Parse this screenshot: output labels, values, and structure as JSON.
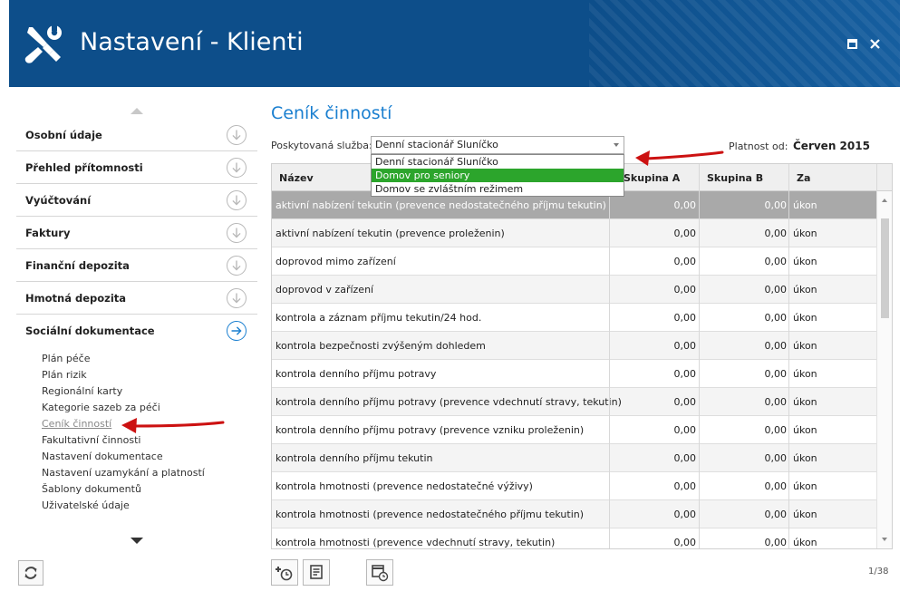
{
  "window": {
    "title": "Nastavení - Klienti",
    "maximize_icon": "maximize-icon",
    "close_icon": "close-icon",
    "header_color": "#0d4e8a"
  },
  "sidebar": {
    "sections": [
      {
        "label": "Osobní údaje",
        "icon": "arrow-down-circle-icon",
        "active": false
      },
      {
        "label": "Přehled přítomnosti",
        "icon": "arrow-down-circle-icon",
        "active": false
      },
      {
        "label": "Vyúčtování",
        "icon": "arrow-down-circle-icon",
        "active": false
      },
      {
        "label": "Faktury",
        "icon": "arrow-down-circle-icon",
        "active": false
      },
      {
        "label": "Finanční depozita",
        "icon": "arrow-down-circle-icon",
        "active": false
      },
      {
        "label": "Hmotná depozita",
        "icon": "arrow-down-circle-icon",
        "active": false
      },
      {
        "label": "Sociální dokumentace",
        "icon": "arrow-right-circle-icon",
        "active": true
      }
    ],
    "subitems": [
      "Plán péče",
      "Plán rizik",
      "Regionální karty",
      "Kategorie sazeb za péči",
      "Ceník činností",
      "Fakultativní činnosti",
      "Nastavení dokumentace",
      "Nastavení uzamykání a platností",
      "Šablony dokumentů",
      "Uživatelské údaje"
    ],
    "active_subitem": "Ceník činností"
  },
  "main": {
    "title": "Ceník činností",
    "service_label": "Poskytovaná služba:",
    "service_value": "Denní stacionář Sluníčko",
    "service_options": [
      {
        "label": "Denní stacionář Sluníčko",
        "selected": false
      },
      {
        "label": "Domov pro seniory",
        "selected": true
      },
      {
        "label": "Domov se zvláštním režimem",
        "selected": false
      }
    ],
    "valid_from_label": "Platnost od:",
    "valid_from_value": "Červen 2015",
    "columns": {
      "name": "Název",
      "group_a": "Skupina A",
      "group_b": "Skupina B",
      "per": "Za"
    },
    "rows": [
      {
        "name": "aktivní nabízení tekutin (prevence nedostatečného příjmu tekutin)",
        "a": "0,00",
        "b": "0,00",
        "per": "úkon",
        "selected": true
      },
      {
        "name": "aktivní nabízení tekutin (prevence proleženin)",
        "a": "0,00",
        "b": "0,00",
        "per": "úkon"
      },
      {
        "name": "doprovod mimo zařízení",
        "a": "0,00",
        "b": "0,00",
        "per": "úkon"
      },
      {
        "name": "doprovod v zařízení",
        "a": "0,00",
        "b": "0,00",
        "per": "úkon"
      },
      {
        "name": "kontrola a záznam příjmu tekutin/24 hod.",
        "a": "0,00",
        "b": "0,00",
        "per": "úkon"
      },
      {
        "name": "kontrola bezpečnosti zvýšeným dohledem",
        "a": "0,00",
        "b": "0,00",
        "per": "úkon"
      },
      {
        "name": "kontrola denního příjmu potravy",
        "a": "0,00",
        "b": "0,00",
        "per": "úkon"
      },
      {
        "name": "kontrola denního příjmu potravy (prevence vdechnutí stravy, tekutin)",
        "a": "0,00",
        "b": "0,00",
        "per": "úkon"
      },
      {
        "name": "kontrola denního příjmu potravy (prevence vzniku proleženin)",
        "a": "0,00",
        "b": "0,00",
        "per": "úkon"
      },
      {
        "name": "kontrola denního příjmu tekutin",
        "a": "0,00",
        "b": "0,00",
        "per": "úkon"
      },
      {
        "name": "kontrola hmotnosti (prevence nedostatečné výživy)",
        "a": "0,00",
        "b": "0,00",
        "per": "úkon"
      },
      {
        "name": "kontrola hmotnosti (prevence nedostatečného příjmu tekutin)",
        "a": "0,00",
        "b": "0,00",
        "per": "úkon"
      },
      {
        "name": "kontrola hmotnosti (prevence vdechnutí stravy, tekutin)",
        "a": "0,00",
        "b": "0,00",
        "per": "úkon"
      }
    ],
    "page_counter": "1/38"
  },
  "toolbar": {
    "add_icon": "add-schedule-icon",
    "edit_icon": "document-edit-icon",
    "history_icon": "calendar-history-icon",
    "refresh_icon": "refresh-icon"
  },
  "annotation_color": "#cc1111"
}
